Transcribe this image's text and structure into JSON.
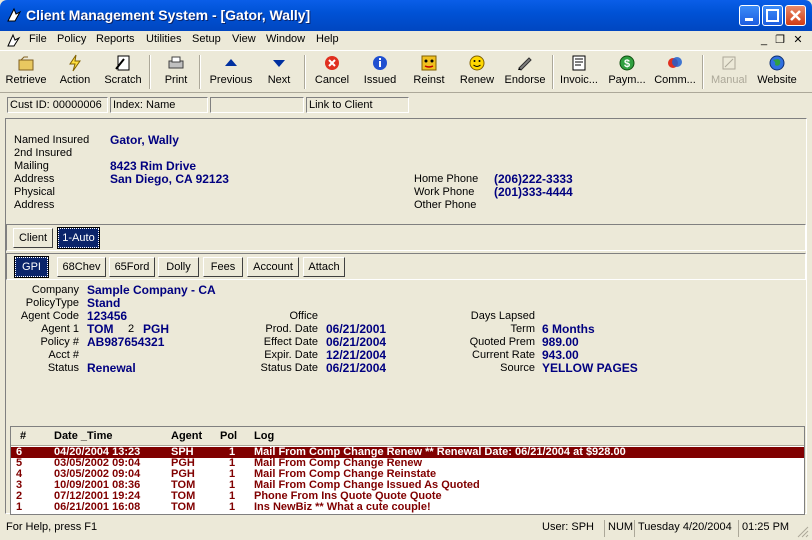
{
  "window": {
    "title": "Client Management System - [Gator, Wally]"
  },
  "menu": [
    "File",
    "Policy",
    "Reports",
    "Utilities",
    "Setup",
    "View",
    "Window",
    "Help"
  ],
  "toolbar": [
    {
      "label": "Retrieve",
      "icon": "retrieve-icon"
    },
    {
      "label": "Action",
      "icon": "action-icon"
    },
    {
      "label": "Scratch",
      "icon": "scratch-icon"
    },
    {
      "label": "Print",
      "icon": "printer-icon"
    },
    {
      "label": "Previous",
      "icon": "arrow-up-icon"
    },
    {
      "label": "Next",
      "icon": "arrow-down-icon"
    },
    {
      "label": "Cancel",
      "icon": "cancel-icon"
    },
    {
      "label": "Issued",
      "icon": "info-icon"
    },
    {
      "label": "Reinst",
      "icon": "reinstate-icon"
    },
    {
      "label": "Renew",
      "icon": "smiley-icon"
    },
    {
      "label": "Endorse",
      "icon": "endorse-icon"
    },
    {
      "label": "Invoic...",
      "icon": "invoice-icon"
    },
    {
      "label": "Paym...",
      "icon": "dollar-icon"
    },
    {
      "label": "Comm...",
      "icon": "commission-icon"
    },
    {
      "label": "Manual",
      "icon": "manual-icon"
    },
    {
      "label": "Website",
      "icon": "globe-icon"
    }
  ],
  "infobar": {
    "cust_id": "Cust ID: 00000006",
    "index": "Index: Name",
    "blank": "",
    "link": "Link to Client"
  },
  "client": {
    "named_insured_label": "Named Insured",
    "named_insured": "Gator, Wally",
    "second_insured_label": "2nd Insured",
    "mailing_label": "Mailing",
    "address_label": "Address",
    "address1": "8423 Rim Drive",
    "address2": "San Diego, CA 92123",
    "physical_label": "Physical",
    "physical_address_label": "Address",
    "home_phone_label": "Home Phone",
    "home_phone": "(206)222-3333",
    "work_phone_label": "Work Phone",
    "work_phone": "(201)333-4444",
    "other_phone_label": "Other Phone"
  },
  "top_tabs": [
    "Client",
    "1-Auto"
  ],
  "policy_tabs": [
    "GPI",
    "68Chev",
    "65Ford",
    "Dolly",
    "Fees",
    "Account",
    "Attach"
  ],
  "policy": {
    "company_label": "Company",
    "company": "Sample Company  - CA",
    "policytype_label": "PolicyType",
    "policytype": "Stand",
    "agent_code_label": "Agent Code",
    "agent_code": "123456",
    "agent1_label": "Agent 1",
    "agent1": "TOM",
    "agent2_num": "2",
    "agent2": "PGH",
    "policy_no_label": "Policy #",
    "policy_no": "AB987654321",
    "acct_label": "Acct #",
    "status_label": "Status",
    "status": "Renewal",
    "office_label": "Office",
    "prod_date_label": "Prod. Date",
    "prod_date": "06/21/2001",
    "effect_date_label": "Effect Date",
    "effect_date": "06/21/2004",
    "expir_date_label": "Expir. Date",
    "expir_date": "12/21/2004",
    "status_date_label": "Status Date",
    "status_date": "06/21/2004",
    "days_lapsed_label": "Days Lapsed",
    "term_label": "Term",
    "term": "6 Months",
    "quoted_prem_label": "Quoted Prem",
    "quoted_prem": "989.00",
    "current_rate_label": "Current Rate",
    "current_rate": "943.00",
    "source_label": "Source",
    "source": "YELLOW PAGES"
  },
  "log": {
    "headers": [
      "#",
      "Date _Time",
      "Agent",
      "Pol",
      "Log"
    ],
    "rows": [
      {
        "n": "6",
        "dt": "04/20/2004 13:23",
        "agent": "SPH",
        "pol": "1",
        "log": "Mail From Comp Change Renew ** Renewal Date: 06/21/2004 at $928.00"
      },
      {
        "n": "5",
        "dt": "03/05/2002 09:04",
        "agent": "PGH",
        "pol": "1",
        "log": "Mail From Comp Change Renew"
      },
      {
        "n": "4",
        "dt": "03/05/2002 09:04",
        "agent": "PGH",
        "pol": "1",
        "log": "Mail From Comp Change Reinstate"
      },
      {
        "n": "3",
        "dt": "10/09/2001 08:36",
        "agent": "TOM",
        "pol": "1",
        "log": "Mail From Comp Change Issued As Quoted"
      },
      {
        "n": "2",
        "dt": "07/12/2001 19:24",
        "agent": "TOM",
        "pol": "1",
        "log": "Phone From Ins Quote Quote Quote"
      },
      {
        "n": "1",
        "dt": "06/21/2001 16:08",
        "agent": "TOM",
        "pol": "1",
        "log": "Ins NewBiz ** What a cute couple!"
      }
    ]
  },
  "status": {
    "help": "For Help, press F1",
    "user": "User: SPH",
    "num": "NUM",
    "date": "Tuesday 4/20/2004",
    "time": "01:25 PM"
  },
  "colors": {
    "selected_row": "#800000",
    "value_text": "#000080",
    "title_bar": "#0052d6"
  }
}
